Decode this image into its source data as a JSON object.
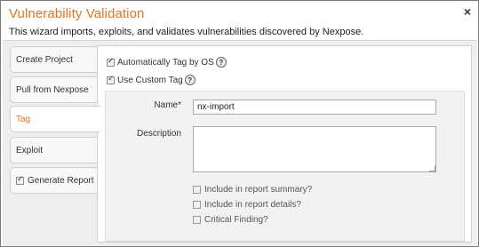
{
  "dialog": {
    "title": "Vulnerability Validation",
    "close_symbol": "×",
    "subtitle": "This wizard imports, exploits, and validates vulnerabilities discovered by Nexpose."
  },
  "tabs": [
    {
      "label": "Create Project",
      "active": false
    },
    {
      "label": "Pull from Nexpose",
      "active": false
    },
    {
      "label": "Tag",
      "active": true
    },
    {
      "label": "Exploit",
      "active": false
    },
    {
      "label": "Generate Report",
      "active": false,
      "checkbox": true,
      "checked": true
    }
  ],
  "tag": {
    "auto_tag": {
      "label": "Automatically Tag by OS",
      "checked": true,
      "help": "?"
    },
    "custom_tag": {
      "label": "Use Custom Tag",
      "checked": true,
      "help": "?"
    },
    "name_label": "Name*",
    "name_value": "nx-import",
    "description_label": "Description",
    "description_value": "",
    "options": [
      {
        "label": "Include in report summary?",
        "checked": false
      },
      {
        "label": "Include in report details?",
        "checked": false
      },
      {
        "label": "Critical Finding?",
        "checked": false
      }
    ]
  },
  "colors": {
    "accent": "#e8731e",
    "frame": "#eeeeee"
  }
}
